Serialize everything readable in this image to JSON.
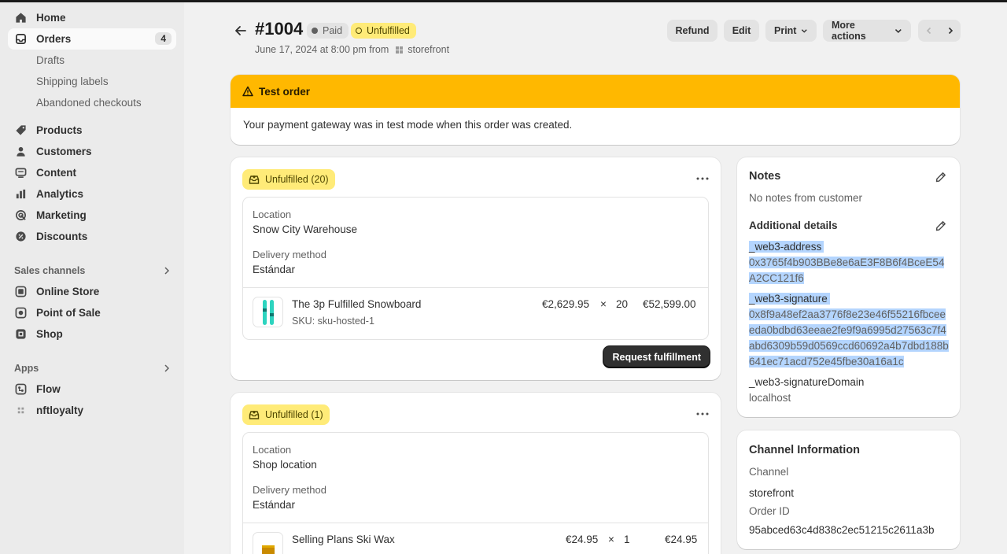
{
  "sidebar": {
    "nav": [
      {
        "label": "Home",
        "icon": "home-icon"
      },
      {
        "label": "Orders",
        "icon": "orders-icon",
        "count": "4"
      },
      {
        "label": "Products",
        "icon": "tag-icon"
      },
      {
        "label": "Customers",
        "icon": "person-icon"
      },
      {
        "label": "Content",
        "icon": "content-icon"
      },
      {
        "label": "Analytics",
        "icon": "chart-icon"
      },
      {
        "label": "Marketing",
        "icon": "target-icon"
      },
      {
        "label": "Discounts",
        "icon": "discount-icon"
      }
    ],
    "orders_sub": [
      "Drafts",
      "Shipping labels",
      "Abandoned checkouts"
    ],
    "sales_channels_title": "Sales channels",
    "sales_channels": [
      {
        "label": "Online Store",
        "icon": "store-icon"
      },
      {
        "label": "Point of Sale",
        "icon": "pos-icon"
      },
      {
        "label": "Shop",
        "icon": "shop-icon"
      }
    ],
    "apps_title": "Apps",
    "apps": [
      {
        "label": "Flow",
        "icon": "flow-icon"
      },
      {
        "label": "nftloyalty",
        "icon": "app-grid-icon"
      }
    ]
  },
  "header": {
    "order_number": "#1004",
    "payment_status": "Paid",
    "fulfillment_status": "Unfulfilled",
    "date_text": "June 17, 2024 at 8:00 pm from",
    "source": "storefront",
    "buttons": {
      "refund": "Refund",
      "edit": "Edit",
      "print": "Print",
      "more": "More actions"
    }
  },
  "banner": {
    "title": "Test order",
    "message": "Your payment gateway was in test mode when this order was created."
  },
  "fulfillments": [
    {
      "badge": "Unfulfilled (20)",
      "location_label": "Location",
      "location": "Snow City Warehouse",
      "delivery_label": "Delivery method",
      "delivery": "Estándar",
      "item_name": "The 3p Fulfilled Snowboard",
      "item_sku": "SKU: sku-hosted-1",
      "item_price": "€2,629.95",
      "item_mul": "×",
      "item_qty": "20",
      "item_total": "€52,599.00",
      "action": "Request fulfillment"
    },
    {
      "badge": "Unfulfilled (1)",
      "location_label": "Location",
      "location": "Shop location",
      "delivery_label": "Delivery method",
      "delivery": "Estándar",
      "item_name": "Selling Plans Ski Wax",
      "item_price": "€24.95",
      "item_mul": "×",
      "item_qty": "1",
      "item_total": "€24.95"
    }
  ],
  "notes": {
    "title": "Notes",
    "text": "No notes from customer",
    "additional_title": "Additional details",
    "details": [
      {
        "key": "_web3-address",
        "value": "0x3765f4b903BBe8e6aE3F8B6f4BceE54A2CC121f6"
      },
      {
        "key": "_web3-signature",
        "value": "0x8f9a48ef2aa3776f8e23e46f55216fbceeeda0bdbd63eeae2fe9f9a6995d27563c7f4abd6309b59d0569ccd60692a4b7dbd188b641ec71acd752e45fbe30a16a1c"
      },
      {
        "key": "_web3-signatureDomain",
        "value": "localhost"
      }
    ]
  },
  "channel": {
    "title": "Channel Information",
    "channel_label": "Channel",
    "channel_value": "storefront",
    "order_id_label": "Order ID",
    "order_id_value": "95abced63c4d838c2ec51215c2611a3b"
  },
  "colors": {
    "accent_yellow": "#ffeb78",
    "banner_orange": "#ffb800",
    "selection": "#b4d5fe"
  }
}
